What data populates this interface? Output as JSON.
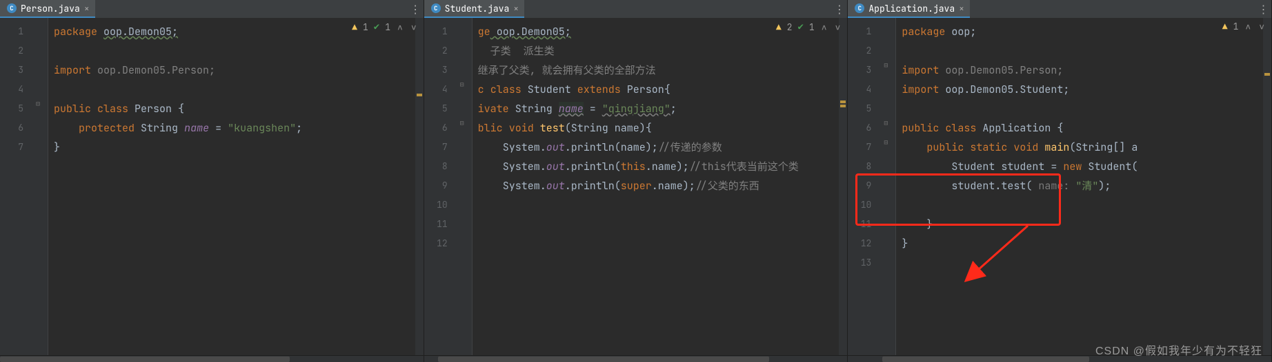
{
  "panes": [
    {
      "tab": {
        "filename": "Person.java",
        "icon": "C"
      },
      "inspections": {
        "warn": 1,
        "check": 1
      },
      "gutter_lines": [
        "1",
        "2",
        "3",
        "4",
        "5",
        "6",
        "7"
      ],
      "code": {
        "l1_package": "package",
        "l1_pkg": "oop.Demon05;",
        "l3_import": "import",
        "l3_sym": "oop.Demon05.Person;",
        "l5_modifiers": "public class",
        "l5_class": "Person",
        "l5_brace": " {",
        "l6_mod": "protected",
        "l6_type": "String",
        "l6_name": "name",
        "l6_eq": " = ",
        "l6_val": "\"kuangshen\"",
        "l6_semi": ";",
        "l7_brace": "}"
      }
    },
    {
      "tab": {
        "filename": "Student.java",
        "icon": "C"
      },
      "inspections": {
        "warn": 2,
        "check": 1
      },
      "gutter_lines": [
        "1",
        "2",
        "3",
        "4",
        "5",
        "6",
        "7",
        "8",
        "9",
        "10",
        "11",
        "12"
      ],
      "code": {
        "l1_ge": "ge",
        "l1_pkg": " oop.Demon05;",
        "l2_cmt": "  子类  派生类",
        "l3_cmt": "继承了父类, 就会拥有父类的全部方法",
        "l4_c": "c ",
        "l4_class": "class",
        "l4_name": " Student ",
        "l4_ext": "extends",
        "l4_parent": " Person{",
        "l5_iv": "ivate ",
        "l5_type": "String ",
        "l5_field": "name",
        "l5_eq": " = ",
        "l5_val": "\"qingjiang\"",
        "l5_semi": ";",
        "l6_pub": "blic ",
        "l6_void": "void",
        "l6_method": " test",
        "l6_params": "(String name){",
        "l7_sys": "System.",
        "l7_out": "out",
        "l7_print": ".println(name);",
        "l7_cmt": "//传递的参数",
        "l8_sys": "System.",
        "l8_out": "out",
        "l8_print_a": ".println(",
        "l8_this": "this",
        "l8_print_b": ".name);",
        "l8_cmt": "//this代表当前这个类",
        "l9_sys": "System.",
        "l9_out": "out",
        "l9_print_a": ".println(",
        "l9_super": "super",
        "l9_print_b": ".name);",
        "l9_cmt": "//父类的东西"
      }
    },
    {
      "tab": {
        "filename": "Application.java",
        "icon": "C"
      },
      "inspections": {
        "warn": 1
      },
      "gutter_lines": [
        "1",
        "2",
        "3",
        "4",
        "5",
        "6",
        "7",
        "8",
        "9",
        "10",
        "11",
        "12",
        "13"
      ],
      "code": {
        "l1_package": "package",
        "l1_pkg": " oop;",
        "l3_import": "import",
        "l3_sym": " oop.Demon05.Person;",
        "l4_import": "import",
        "l4_sym": " oop.Demon05.Student;",
        "l6_mod": "public class",
        "l6_name": " Application {",
        "l7_mod": "public static void",
        "l7_main": " main",
        "l7_params": "(String[] a",
        "l8_type": "Student",
        "l8_rest": " student = ",
        "l8_new": "new",
        "l8_ctor": " Student(",
        "l9_call": "student.test( ",
        "l9_hint": "name:",
        "l9_arg": " \"清\"",
        "l9_end": ");",
        "l11_brace": "}",
        "l12_brace": "}"
      }
    }
  ],
  "labels": {
    "more": "⋮",
    "close": "×",
    "up": "∧",
    "down": "∨"
  },
  "watermark": "CSDN @假如我年少有为不轻狂"
}
